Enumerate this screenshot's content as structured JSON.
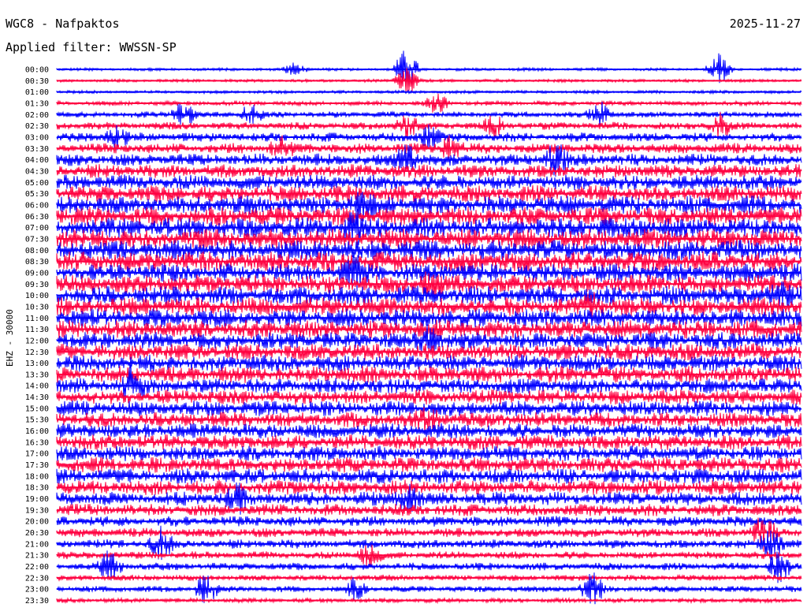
{
  "header": {
    "station": "WGC8 - Nafpaktos",
    "date": "2025-11-27",
    "filter": "Applied filter: WWSSN-SP"
  },
  "chart_data": {
    "type": "line",
    "title": "WGC8 - Nafpaktos",
    "ylabel": "EHZ - 30000",
    "row_labels": [
      "00:00",
      "00:30",
      "01:00",
      "01:30",
      "02:00",
      "02:30",
      "03:00",
      "03:30",
      "04:00",
      "04:30",
      "05:00",
      "05:30",
      "06:00",
      "06:30",
      "07:00",
      "07:30",
      "08:00",
      "08:30",
      "09:00",
      "09:30",
      "10:00",
      "10:30",
      "11:00",
      "11:30",
      "12:00",
      "12:30",
      "13:00",
      "13:30",
      "14:00",
      "14:30",
      "15:00",
      "15:30",
      "16:00",
      "16:30",
      "17:00",
      "17:30",
      "18:00",
      "18:30",
      "19:00",
      "19:30",
      "20:00",
      "20:30",
      "21:00",
      "21:30",
      "22:00",
      "22:30",
      "23:00",
      "23:30"
    ],
    "colors": [
      "#0000ff",
      "#ff0040"
    ],
    "noise_amplitude": [
      2,
      2,
      2,
      3,
      4,
      5,
      6,
      7,
      8,
      9,
      10,
      11,
      12,
      12,
      13,
      13,
      13,
      13,
      12,
      12,
      12,
      12,
      12,
      12,
      11,
      11,
      11,
      11,
      10,
      10,
      10,
      10,
      10,
      10,
      10,
      10,
      10,
      10,
      9,
      8,
      7,
      6,
      6,
      5,
      5,
      4,
      4,
      3
    ],
    "events": [
      {
        "row": 0,
        "pos": 0.32,
        "amp": 8
      },
      {
        "row": 0,
        "pos": 0.47,
        "amp": 28
      },
      {
        "row": 0,
        "pos": 0.89,
        "amp": 20
      },
      {
        "row": 1,
        "pos": 0.47,
        "amp": 20
      },
      {
        "row": 3,
        "pos": 0.51,
        "amp": 14
      },
      {
        "row": 4,
        "pos": 0.17,
        "amp": 16
      },
      {
        "row": 4,
        "pos": 0.26,
        "amp": 12
      },
      {
        "row": 4,
        "pos": 0.73,
        "amp": 16
      },
      {
        "row": 5,
        "pos": 0.47,
        "amp": 16
      },
      {
        "row": 5,
        "pos": 0.59,
        "amp": 14
      },
      {
        "row": 5,
        "pos": 0.89,
        "amp": 16
      },
      {
        "row": 6,
        "pos": 0.08,
        "amp": 12
      },
      {
        "row": 6,
        "pos": 0.5,
        "amp": 14
      },
      {
        "row": 7,
        "pos": 0.3,
        "amp": 14
      },
      {
        "row": 7,
        "pos": 0.53,
        "amp": 16
      },
      {
        "row": 8,
        "pos": 0.67,
        "amp": 22
      },
      {
        "row": 8,
        "pos": 0.47,
        "amp": 18
      },
      {
        "row": 12,
        "pos": 0.41,
        "amp": 14
      },
      {
        "row": 14,
        "pos": 0.4,
        "amp": 16
      },
      {
        "row": 18,
        "pos": 0.4,
        "amp": 14
      },
      {
        "row": 19,
        "pos": 0.5,
        "amp": 12
      },
      {
        "row": 20,
        "pos": 0.97,
        "amp": 14
      },
      {
        "row": 21,
        "pos": 0.72,
        "amp": 12
      },
      {
        "row": 24,
        "pos": 0.5,
        "amp": 14
      },
      {
        "row": 28,
        "pos": 0.1,
        "amp": 18
      },
      {
        "row": 31,
        "pos": 0.5,
        "amp": 14
      },
      {
        "row": 38,
        "pos": 0.24,
        "amp": 18
      },
      {
        "row": 38,
        "pos": 0.47,
        "amp": 16
      },
      {
        "row": 41,
        "pos": 0.95,
        "amp": 22
      },
      {
        "row": 42,
        "pos": 0.14,
        "amp": 20
      },
      {
        "row": 42,
        "pos": 0.96,
        "amp": 18
      },
      {
        "row": 43,
        "pos": 0.42,
        "amp": 16
      },
      {
        "row": 44,
        "pos": 0.07,
        "amp": 18
      },
      {
        "row": 44,
        "pos": 0.97,
        "amp": 20
      },
      {
        "row": 46,
        "pos": 0.2,
        "amp": 18
      },
      {
        "row": 46,
        "pos": 0.72,
        "amp": 22
      },
      {
        "row": 46,
        "pos": 0.4,
        "amp": 12
      }
    ]
  }
}
